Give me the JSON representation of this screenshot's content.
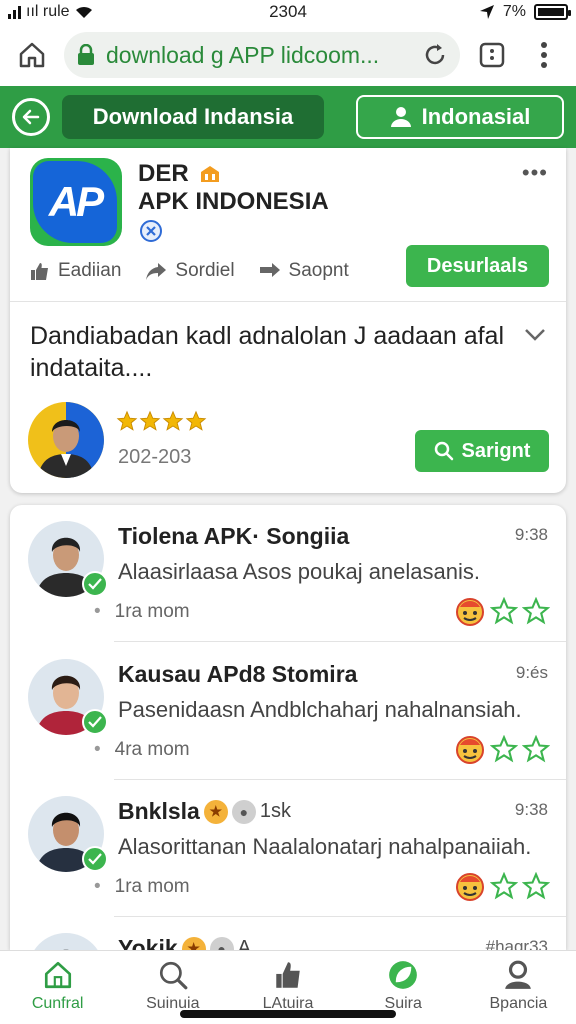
{
  "status_bar": {
    "carrier": "ııl rule",
    "time": "2304",
    "battery": "7%"
  },
  "browser": {
    "url": "download g APP lidcoom..."
  },
  "header": {
    "download_tab": "Download Indansia",
    "indonesia_tab": "Indonasial"
  },
  "app_card": {
    "name_line1": "DER",
    "name_line2": "APK INDONESIA",
    "actions": [
      "Eadiian",
      "Sordiel",
      "Saopnt"
    ],
    "download_button": "Desurlaals",
    "description": "Dandiabadan kadl adnalolan J aadaan afal indataita....",
    "rating": 4,
    "rating_text": "202-203",
    "search_button": "Sarignt"
  },
  "posts": [
    {
      "title": "Tiolena APK· Songiia",
      "time": "9:38",
      "body": "Alaasirlaasa Asos poukaj anelasanis.",
      "meta": "1ra mom",
      "skin": "#c99a78",
      "shirt": "#2a2a2a",
      "hair": "#222"
    },
    {
      "title": "Kausau APd8 Stomira",
      "time": "9:és",
      "body": "Pasenidaasn Andblchaharj nahalnansiah.",
      "meta": "4ra mom",
      "skin": "#e2b594",
      "shirt": "#b0243a",
      "hair": "#2b1c14"
    },
    {
      "title": "Bnklsla",
      "time": "9:38",
      "body": "Alasorittanan Naalalonatarj nahalpanaiiah.",
      "meta": "1ra mom",
      "skin": "#c48f6d",
      "shirt": "#263040",
      "hair": "#111",
      "extra_count": "1sk"
    },
    {
      "title": "Yokik",
      "time": "#hagr33",
      "body": "",
      "meta": "",
      "skin": "#c99a78",
      "shirt": "#333",
      "hair": "#222",
      "extra_count": "A"
    }
  ],
  "bottom_nav": [
    {
      "label": "Cunfral",
      "icon": "home-icon",
      "active": true
    },
    {
      "label": "Suinuia",
      "icon": "search-icon",
      "active": false
    },
    {
      "label": "LAtuira",
      "icon": "thumb-icon",
      "active": false
    },
    {
      "label": "Suira",
      "icon": "leaf-icon",
      "active": false
    },
    {
      "label": "Bpancia",
      "icon": "profile-icon",
      "active": false
    }
  ],
  "colors": {
    "primary_green": "#2f9d45",
    "dark_green": "#1f6e33",
    "button_green": "#3cb54e",
    "brand_blue": "#1565d8",
    "star_yellow": "#f2b705"
  }
}
